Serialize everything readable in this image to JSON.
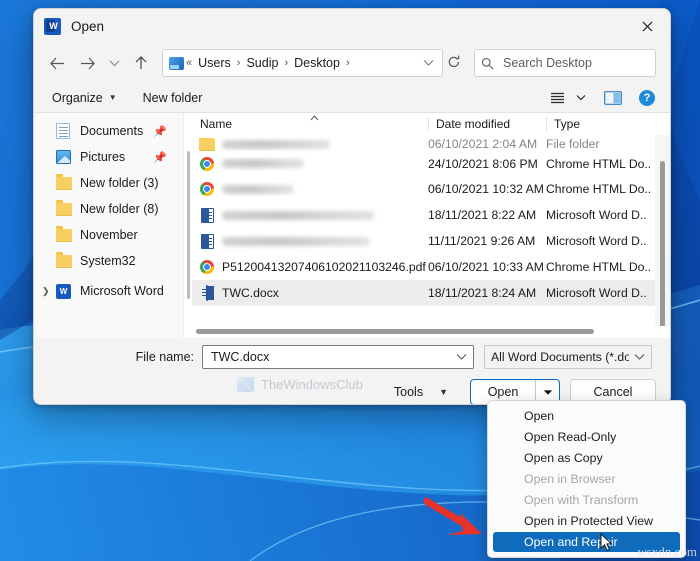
{
  "window": {
    "title": "Open",
    "app_icon": "word-icon",
    "close_label": "✕"
  },
  "nav": {
    "back": "back-arrow-icon",
    "forward": "forward-arrow-icon",
    "recent": "chevron-down-icon",
    "up": "up-arrow-icon",
    "breadcrumbs": [
      "Users",
      "Sudip",
      "Desktop"
    ],
    "breadcrumb_prefix": "«",
    "breadcrumb_sep": "›",
    "refresh": "refresh-icon"
  },
  "search": {
    "placeholder": "Search Desktop",
    "value": "",
    "icon": "search-icon"
  },
  "commandbar": {
    "organize": "Organize",
    "new_folder": "New folder",
    "view_icon": "list-view-icon",
    "pane_icon": "preview-pane-icon",
    "help_icon": "help-icon",
    "help_glyph": "?"
  },
  "sidebar": {
    "items": [
      {
        "label": "Documents",
        "icon": "documents-icon",
        "pinned": true,
        "expander": false
      },
      {
        "label": "Pictures",
        "icon": "pictures-icon",
        "pinned": true,
        "expander": false
      },
      {
        "label": "New folder (3)",
        "icon": "folder-icon",
        "pinned": false,
        "expander": false
      },
      {
        "label": "New folder (8)",
        "icon": "folder-icon",
        "pinned": false,
        "expander": false
      },
      {
        "label": "November",
        "icon": "folder-icon",
        "pinned": false,
        "expander": false
      },
      {
        "label": "System32",
        "icon": "folder-icon",
        "pinned": false,
        "expander": false
      },
      {
        "label": "Microsoft Word",
        "icon": "word-app-icon",
        "pinned": false,
        "expander": true
      }
    ]
  },
  "filelist": {
    "columns": [
      "Name",
      "Date modified",
      "Type"
    ],
    "sort_indicator": "ascending",
    "rows": [
      {
        "name": "",
        "blurred": true,
        "blur_width": 108,
        "icon": "folder-icon",
        "date": "06/10/2021 2:04 AM",
        "type": "File folder",
        "selected": false,
        "clipped_top": true
      },
      {
        "name": "",
        "blurred": true,
        "blur_width": 82,
        "icon": "chrome-icon",
        "date": "24/10/2021 8:06 PM",
        "type": "Chrome HTML Do..",
        "selected": false
      },
      {
        "name": "",
        "blurred": true,
        "blur_width": 72,
        "icon": "chrome-icon",
        "date": "06/10/2021 10:32 AM",
        "type": "Chrome HTML Do..",
        "selected": false
      },
      {
        "name": "",
        "blurred": true,
        "blur_width": 152,
        "icon": "word-doc-icon",
        "date": "18/11/2021 8:22 AM",
        "type": "Microsoft Word D..",
        "selected": false
      },
      {
        "name": "",
        "blurred": true,
        "blur_width": 148,
        "icon": "word-doc-icon",
        "date": "11/11/2021 9:26 AM",
        "type": "Microsoft Word D..",
        "selected": false
      },
      {
        "name": "P51200413207406102021103246.pdf",
        "blurred": false,
        "blur_width": 0,
        "icon": "chrome-icon",
        "date": "06/10/2021 10:33 AM",
        "type": "Chrome HTML Do..",
        "selected": false
      },
      {
        "name": "TWC.docx",
        "blurred": false,
        "blur_width": 0,
        "icon": "word-doc-icon",
        "date": "18/11/2021 8:24 AM",
        "type": "Microsoft Word D..",
        "selected": true
      }
    ]
  },
  "footer": {
    "file_name_label": "File name:",
    "file_name_value": "TWC.docx",
    "file_name_placeholder": "File name",
    "file_type_value": "All Word Documents (*.docx;*.ι",
    "tools_label": "Tools",
    "open_label": "Open",
    "open_split_caret": "▼",
    "cancel_label": "Cancel",
    "watermark": "TheWindowsClub"
  },
  "open_menu": {
    "items": [
      {
        "label": "Open",
        "state": "normal"
      },
      {
        "label": "Open Read-Only",
        "state": "normal"
      },
      {
        "label": "Open as Copy",
        "state": "normal"
      },
      {
        "label": "Open in Browser",
        "state": "disabled"
      },
      {
        "label": "Open with Transform",
        "state": "disabled"
      },
      {
        "label": "Open in Protected View",
        "state": "normal"
      },
      {
        "label": "Open and Repair",
        "state": "highlight"
      }
    ]
  },
  "annotations": {
    "red_arrow": "red-arrow-pointing-to-open-and-repair",
    "red_arrow_color": "#e8322a",
    "cursor": "mouse-pointer"
  },
  "source_watermark": "wsxdn.com",
  "colors": {
    "accent": "#0f6cbd",
    "selection": "#ececec",
    "dialog_bg": "#f3f3f3",
    "desktop": "#0a58c9"
  }
}
